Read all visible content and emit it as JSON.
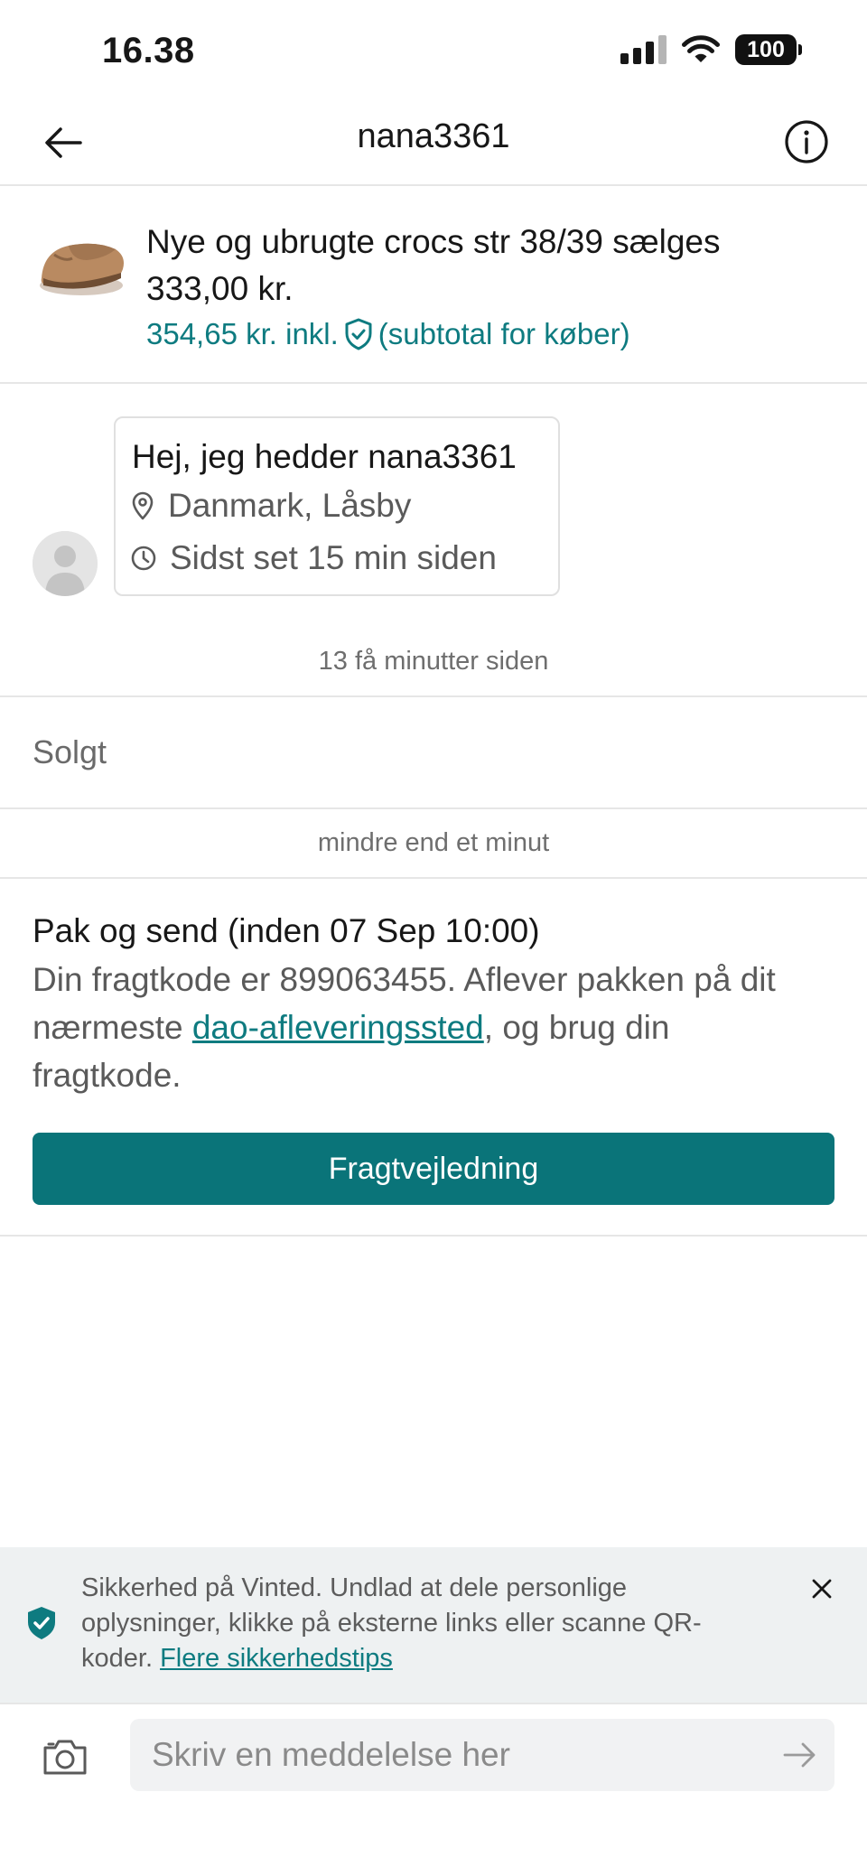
{
  "status_bar": {
    "time": "16.38",
    "battery": "100",
    "icons": [
      "cellular-signal-icon",
      "wifi-icon",
      "battery-icon"
    ]
  },
  "header": {
    "title": "nana3361",
    "back_icon": "arrow-left-icon",
    "info_icon": "info-icon"
  },
  "item": {
    "title": "Nye og ubrugte crocs str 38/39 sælges",
    "price": "333,00 kr.",
    "buyer_price_prefix": "354,65 kr. inkl.",
    "buyer_price_suffix": "(subtotal for køber)",
    "accent_color": "#0e7b80"
  },
  "profile_card": {
    "greeting": "Hej, jeg hedder nana3361",
    "location": "Danmark, Låsby",
    "last_seen": "Sidst set 15 min siden"
  },
  "timeline": {
    "timestamp_1": "13 få minutter siden",
    "sold_label": "Solgt",
    "timestamp_2": "mindre end et minut"
  },
  "shipping": {
    "title": "Pak og send (inden 07 Sep 10:00)",
    "text_before_link": "Din fragtkode er 899063455. Aflever pakken på dit nærmeste ",
    "link_text": "dao-afleveringssted",
    "text_after_link": ", og brug din fragtkode.",
    "button_label": "Fragtvejledning",
    "button_color": "#0a7479"
  },
  "safety_banner": {
    "text": "Sikkerhed på Vinted. Undlad at dele personlige oplysninger, klikke på eksterne links eller scanne QR-koder. ",
    "link_text": "Flere sikkerhedstips"
  },
  "composer": {
    "placeholder": "Skriv en meddelelse her",
    "value": ""
  }
}
